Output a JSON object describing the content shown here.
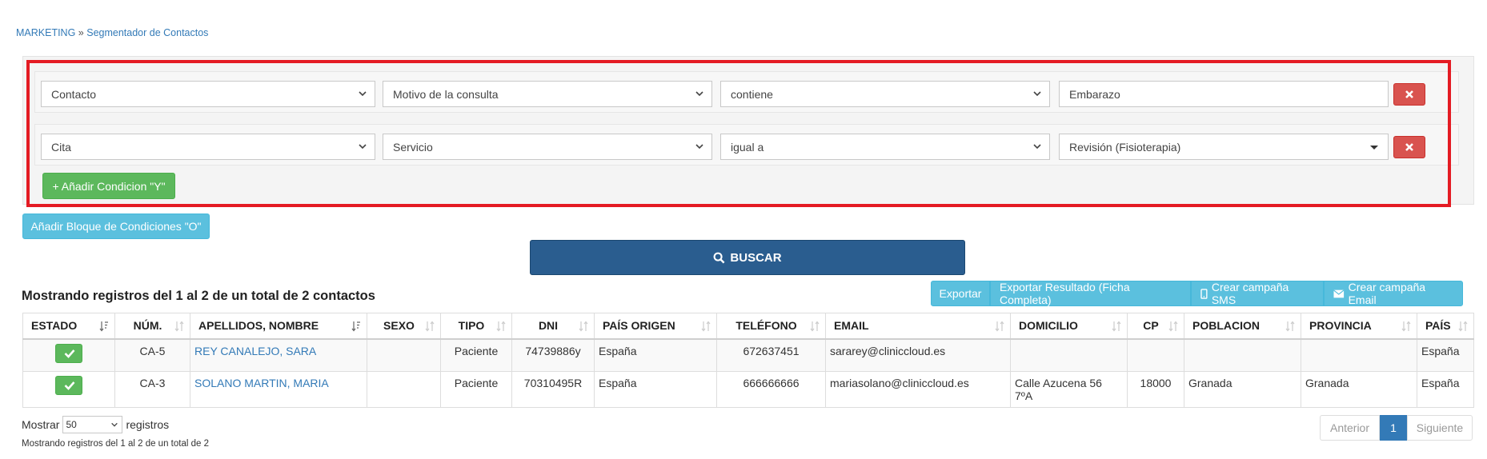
{
  "breadcrumb": {
    "section": "MARKETING",
    "separator": "»",
    "page": "Segmentador de Contactos"
  },
  "conditions": [
    {
      "field_group": "Contacto",
      "field": "Motivo de la consulta",
      "operator": "contiene",
      "value": "Embarazo"
    },
    {
      "field_group": "Cita",
      "field": "Servicio",
      "operator": "igual a",
      "value": "Revisión (Fisioterapia)"
    }
  ],
  "buttons": {
    "add_condition_and": "+ Añadir Condicion \"Y\"",
    "add_block_or": "Añadir Bloque de Condiciones \"O\"",
    "search": "BUSCAR"
  },
  "results": {
    "title": "Mostrando registros del 1 al 2 de un total de 2 contactos",
    "export_buttons": [
      "Exportar",
      "Exportar Resultado (Ficha Completa)",
      "Crear campaña SMS",
      "Crear campaña Email"
    ]
  },
  "table": {
    "columns": [
      "ESTADO",
      "NÚM.",
      "APELLIDOS, NOMBRE",
      "SEXO",
      "TIPO",
      "DNI",
      "PAÍS ORIGEN",
      "TELÉFONO",
      "EMAIL",
      "DOMICILIO",
      "CP",
      "POBLACION",
      "PROVINCIA",
      "PAÍS"
    ],
    "rows": [
      {
        "num": "CA-5",
        "name": "REY CANALEJO, SARA",
        "sexo": "",
        "tipo": "Paciente",
        "dni": "74739886y",
        "pais_origen": "España",
        "telefono": "672637451",
        "email": "sararey@cliniccloud.es",
        "domicilio": "",
        "cp": "",
        "poblacion": "",
        "provincia": "",
        "pais": "España"
      },
      {
        "num": "CA-3",
        "name": "SOLANO MARTIN, MARIA",
        "sexo": "",
        "tipo": "Paciente",
        "dni": "70310495R",
        "pais_origen": "España",
        "telefono": "666666666",
        "email": "mariasolano@cliniccloud.es",
        "domicilio": "Calle Azucena 56 7ºA",
        "cp": "18000",
        "poblacion": "Granada",
        "provincia": "Granada",
        "pais": "España"
      }
    ]
  },
  "footer": {
    "show_label": "Mostrar",
    "show_value": "50",
    "records_label": "registros",
    "info": "Mostrando registros del 1 al 2 de un total de 2",
    "pagination": {
      "prev": "Anterior",
      "current": "1",
      "next": "Siguiente"
    }
  },
  "colors": {
    "accent_blue": "#2a5d8f",
    "info_blue": "#5bc0de",
    "success_green": "#5cb85c",
    "danger_red": "#d9534f",
    "highlight_red": "#e41b23",
    "link_blue": "#337ab7"
  },
  "icons": [
    "chevron-down-icon",
    "remove-icon",
    "search-icon",
    "mobile-icon",
    "envelope-icon",
    "sort-icon",
    "sort-asc-icon",
    "check-icon"
  ]
}
